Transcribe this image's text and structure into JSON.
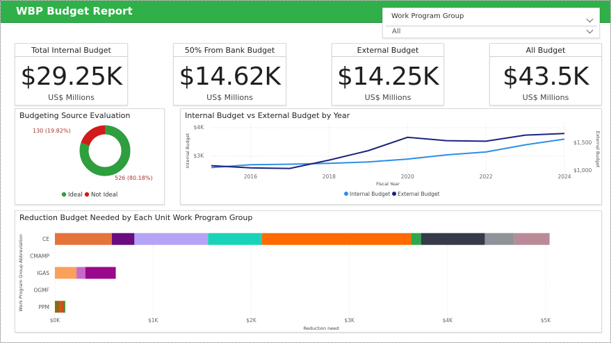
{
  "header": {
    "title": "WBP Budget Report",
    "bg_color": "#2fb048"
  },
  "slicer": {
    "label": "Work Program Group",
    "selected": "All"
  },
  "kpis": [
    {
      "title": "Total Internal Budget",
      "value": "$29.25K",
      "unit": "US$ Millions"
    },
    {
      "title": "50% From Bank Budget",
      "value": "$14.62K",
      "unit": "US$ Millions"
    },
    {
      "title": "External Budget",
      "value": "$14.25K",
      "unit": "US$ Millions"
    },
    {
      "title": "All Budget",
      "value": "$43.5K",
      "unit": "US$ Millions"
    }
  ],
  "donut": {
    "title": "Budgeting Source Evaluation",
    "label_ideal": "526 (80.18%)",
    "label_not_ideal": "130 (19.82%)",
    "legend": [
      "Ideal",
      "Not Ideal"
    ]
  },
  "line_chart_title": "Internal Budget vs External Budget by Year",
  "bar_chart_title": "Reduction Budget Needed by Each Unit Work Program Group",
  "chart_data": [
    {
      "type": "pie",
      "title": "Budgeting Source Evaluation",
      "categories": [
        "Ideal",
        "Not Ideal"
      ],
      "values": [
        526,
        130
      ],
      "percentages": [
        80.18,
        19.82
      ],
      "colors": [
        "#2e9e3e",
        "#d01c1c"
      ],
      "legend": "bottom"
    },
    {
      "type": "line",
      "title": "Internal Budget vs External Budget by Year",
      "xlabel": "Fiscal Year",
      "ylabel_left": "Internal Budget",
      "ylabel_right": "External Budget",
      "x": [
        2015,
        2016,
        2017,
        2018,
        2019,
        2020,
        2021,
        2022,
        2023,
        2024
      ],
      "x_ticks": [
        "2016",
        "2018",
        "2020",
        "2022",
        "2024"
      ],
      "y_left_ticks": [
        "$4K",
        "$3K"
      ],
      "y_right_ticks": [
        "$1,500",
        "$1,000"
      ],
      "series": [
        {
          "name": "Internal Budget",
          "axis": "left",
          "color": "#2d8de8",
          "values": [
            2600,
            2700,
            2720,
            2750,
            2800,
            2900,
            3050,
            3150,
            3400,
            3600
          ]
        },
        {
          "name": "External Budget",
          "axis": "right",
          "color": "#1a237e",
          "values": [
            1080,
            1040,
            1030,
            1180,
            1350,
            1590,
            1530,
            1520,
            1630,
            1660
          ]
        }
      ],
      "legend": "bottom"
    },
    {
      "type": "bar",
      "orientation": "horizontal-stacked",
      "title": "Reduction Budget Needed by Each Unit Work Program Group",
      "xlabel": "Reduction need",
      "ylabel": "Work Program Group Abbreviation",
      "categories": [
        "CE",
        "CMAMP",
        "IGAS",
        "OGMF",
        "PPM"
      ],
      "x_ticks": [
        "$0K",
        "$1K",
        "$2K",
        "$3K",
        "$4K",
        "$5K"
      ],
      "xlim": [
        0,
        5000
      ],
      "segments": [
        {
          "category": "CE",
          "values": [
            580,
            230,
            750,
            550,
            1520,
            100,
            650,
            300,
            360
          ],
          "colors": [
            "#e5733b",
            "#6a0b7e",
            "#b5a3f5",
            "#19d3b9",
            "#ff6a00",
            "#2ea84a",
            "#353b48",
            "#8e9399",
            "#b98b97"
          ]
        },
        {
          "category": "CMAMP",
          "values": [],
          "colors": []
        },
        {
          "category": "IGAS",
          "values": [
            220,
            90,
            310
          ],
          "colors": [
            "#f9a05a",
            "#c56ac9",
            "#9a088c"
          ]
        },
        {
          "category": "OGMF",
          "values": [],
          "colors": []
        },
        {
          "category": "PPM",
          "values": [
            55,
            30,
            20
          ],
          "colors": [
            "#8a6d12",
            "#d84a1b",
            "#4a8a2a"
          ]
        }
      ]
    }
  ]
}
